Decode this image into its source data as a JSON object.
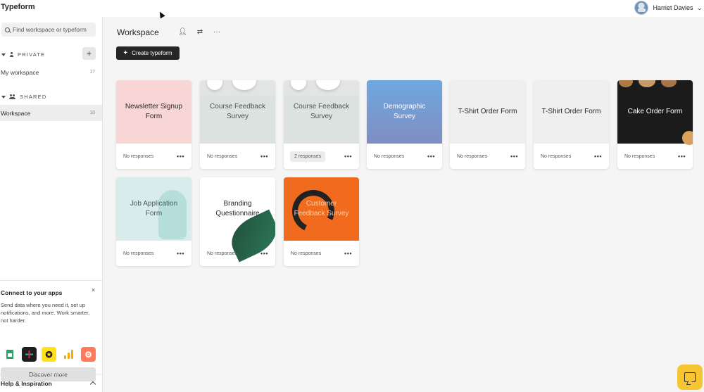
{
  "app": {
    "brand": "Typeform"
  },
  "user": {
    "name": "Harriet Davies",
    "avatar_icon": "avatar-photo",
    "menu_icon": "chevron-down-icon"
  },
  "sidebar": {
    "search_placeholder": "Find workspace or typeform",
    "private": {
      "label": "PRIVATE",
      "add_label": "+"
    },
    "private_items": [
      {
        "label": "My workspace",
        "count": "17"
      }
    ],
    "shared": {
      "label": "SHARED"
    },
    "shared_items": [
      {
        "label": "Workspace",
        "count": "10",
        "active": true
      }
    ],
    "connect": {
      "title": "Connect to your apps",
      "close": "×",
      "text": "Send data where you need it, set up notifications, and more. Work smarter, not harder.",
      "apps": [
        "google-sheets-icon",
        "slack-icon",
        "mailchimp-icon",
        "google-analytics-icon",
        "hubspot-icon"
      ],
      "button_label": "Discover more"
    },
    "help_label": "Help & Inspiration"
  },
  "main": {
    "title": "Workspace",
    "header_icons": [
      "add-member-icon",
      "sync-icon",
      "more-icon"
    ],
    "create_label": "Create typeform",
    "create_icon": "+",
    "forms": [
      {
        "title": "Newsletter Signup Form",
        "responses": "No responses",
        "theme": "#f8d6d6"
      },
      {
        "title": "Course Feedback Survey",
        "responses": "No responses",
        "theme": "#dbe2e0"
      },
      {
        "title": "Course Feedback Survey",
        "responses": "2 responses",
        "theme": "#dbe2e0"
      },
      {
        "title": "Demographic Survey",
        "responses": "No responses",
        "theme": "#6fa7e0"
      },
      {
        "title": "T-Shirt Order Form",
        "responses": "No responses",
        "theme": "#efefef"
      },
      {
        "title": "T-Shirt Order Form",
        "responses": "No responses",
        "theme": "#efefef"
      },
      {
        "title": "Cake Order Form",
        "responses": "No responses",
        "theme": "#1c1b1b"
      },
      {
        "title": "Job Application Form",
        "responses": "No responses",
        "theme": "#d8ecec"
      },
      {
        "title": "Branding Questionnaire",
        "responses": "No responses",
        "theme": "#ffffff"
      },
      {
        "title": "Customer Feedback Survey",
        "responses": "No responses",
        "theme": "#f06b1d"
      }
    ],
    "more_label": "•••"
  },
  "help_chat": {
    "icon": "chat-icon",
    "color": "#f7c531"
  }
}
